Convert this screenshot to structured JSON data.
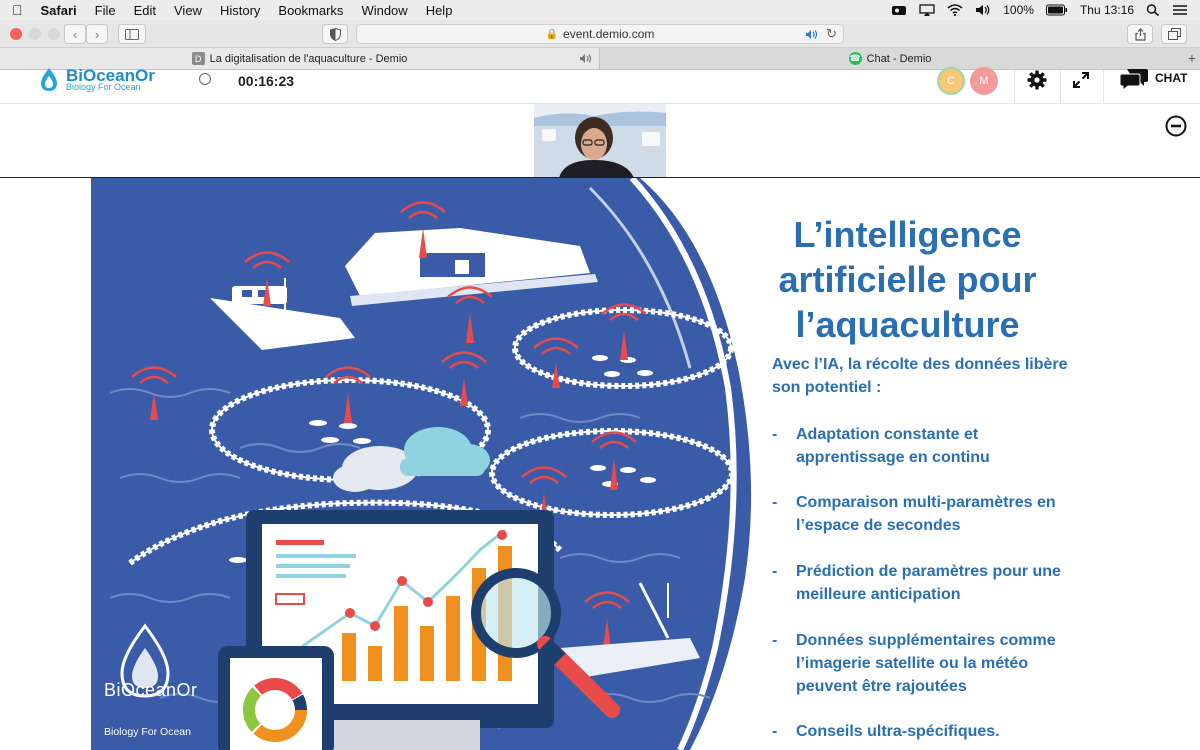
{
  "menubar": {
    "app_name": "Safari",
    "items": [
      "File",
      "Edit",
      "View",
      "History",
      "Bookmarks",
      "Window",
      "Help"
    ],
    "battery": "100%",
    "clock": "Thu 13:16"
  },
  "browser": {
    "url": "event.demio.com",
    "tabs": [
      {
        "title": "La digitalisation de l'aquaculture - Demio",
        "favicon": "D"
      },
      {
        "title": "Chat - Demio"
      }
    ]
  },
  "demio": {
    "brand_name": "BiOceanOr",
    "brand_tagline": "Biology For Ocean",
    "timer": "00:16:23",
    "attendees": [
      "C",
      "M"
    ],
    "chat_label": "CHAT"
  },
  "slide": {
    "title_lines": [
      "L’intelligence",
      "artificielle pour",
      "l’aquaculture"
    ],
    "intro_lines": [
      "Avec l’IA, la récolte des données libère",
      "son potentiel :"
    ],
    "bullets": [
      {
        "line1": "Adaptation constante et",
        "line2": "apprentissage en continu"
      },
      {
        "line1": "Comparaison multi-paramètres en",
        "line2": "l’espace de secondes"
      },
      {
        "line1": "Prédiction de paramètres pour une",
        "line2": "meilleure anticipation"
      },
      {
        "line1": "Données supplémentaires comme",
        "line2": "l’imagerie satellite ou la météo",
        "line3": "peuvent être rajoutées"
      },
      {
        "line1": "Conseils ultra-spécifiques."
      }
    ],
    "bullet_dash": "-",
    "footer_brand": "BiOceanOr",
    "footer_tagline": "Biology For Ocean"
  },
  "colors": {
    "slide_blue": "#3a5ca8",
    "text_blue": "#2b6fb3",
    "signal_red": "#e94b4b",
    "bar_orange": "#f0901e"
  }
}
